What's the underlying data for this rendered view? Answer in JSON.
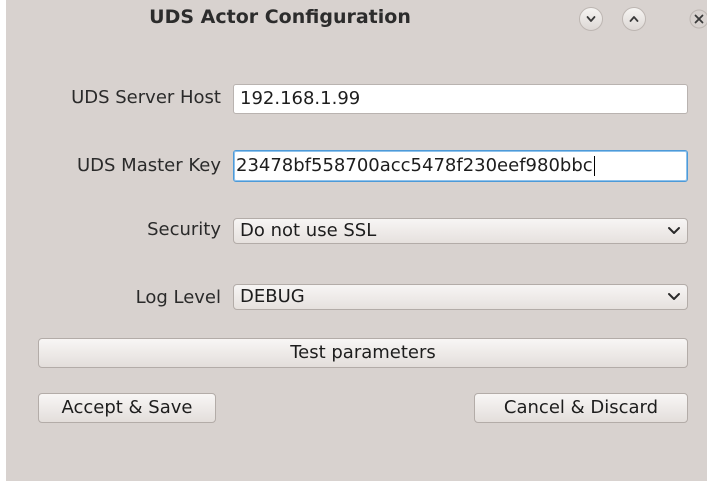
{
  "window": {
    "title": "UDS Actor Configuration"
  },
  "form": {
    "host_label": "UDS Server Host",
    "host_value": "192.168.1.99",
    "key_label": "UDS Master Key",
    "key_value": "23478bf558700acc5478f230eef980bbc",
    "security_label": "Security",
    "security_value": "Do not use SSL",
    "loglevel_label": "Log Level",
    "loglevel_value": "DEBUG"
  },
  "buttons": {
    "test": "Test parameters",
    "accept": "Accept & Save",
    "cancel": "Cancel & Discard"
  },
  "icons": {
    "minimize": "chevron-down-icon",
    "maximize": "chevron-up-icon",
    "close": "close-icon"
  }
}
